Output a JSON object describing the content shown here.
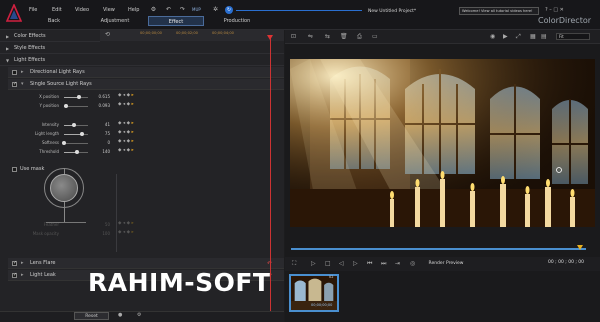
{
  "app": {
    "brand": "ColorDirector",
    "project_title": "New Untitled Project*",
    "mup": "MUP"
  },
  "menu": [
    "File",
    "Edit",
    "Video",
    "View",
    "Help"
  ],
  "mode_tabs": [
    {
      "label": "Back"
    },
    {
      "label": "Adjustment"
    },
    {
      "label": "Effect"
    },
    {
      "label": "Production"
    }
  ],
  "welcome": "Welcome! View all tutorial videos here!",
  "window_controls": "?  –  □  ✕",
  "sections": {
    "color_effects": "Color Effects",
    "style_effects": "Style Effects",
    "light_effects": "Light Effects"
  },
  "timeline_ticks": [
    "00;00;00;00",
    "00;00;02;00",
    "00;00;04;00"
  ],
  "effects": {
    "directional": "Directional Light Rays",
    "single_source": "Single Source Light Rays",
    "use_mask": "Use mask",
    "lens_flare": "Lens Flare",
    "light_leak": "Light Leak"
  },
  "params": [
    {
      "label": "X position",
      "value": "0.615",
      "level": 0.62
    },
    {
      "label": "Y position",
      "value": "0.093",
      "level": 0.1
    },
    {
      "label": "Intensity",
      "value": "41",
      "level": 0.41
    },
    {
      "label": "Light length",
      "value": "75",
      "level": 0.75
    },
    {
      "label": "Softness",
      "value": "0",
      "level": 0.0
    },
    {
      "label": "Threshold",
      "value": "140",
      "level": 0.55
    }
  ],
  "mask_params": [
    {
      "label": "Feather",
      "value": "50"
    },
    {
      "label": "Mask opacity",
      "value": "100"
    }
  ],
  "reset_label": "Reset",
  "preview": {
    "fit": "Fit",
    "render_label": "Render Preview",
    "timecode": "00 ; 00 ; 00 ; 00"
  },
  "thumbnail": {
    "label": "00;00;00;00",
    "count": "02"
  },
  "watermark": "RAHIM-SOFT",
  "colors": {
    "accent": "#4a8fcf",
    "keyframe": "#e0a020",
    "playhead": "#cc3333"
  }
}
